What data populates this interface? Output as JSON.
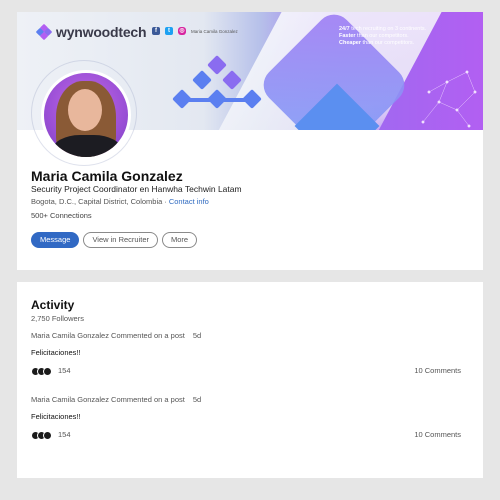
{
  "banner": {
    "brand": "wynwoodtech",
    "social_handle": "Maria Camila Gonzalez",
    "taglines": [
      {
        "bold": "24/7",
        "text": " tech recruiting on 3 continents."
      },
      {
        "bold": "Faster",
        "text": " than our competitors."
      },
      {
        "bold": "Cheaper",
        "text": " than our competitors."
      }
    ],
    "colors": {
      "accent_purple": "#b25ff2",
      "accent_blue": "#5b7ff0"
    }
  },
  "profile": {
    "name": "Maria Camila Gonzalez",
    "headline": "Security Project Coordinator en Hanwha Techwin Latam",
    "location": "Bogota, D.C., Capital District, Colombia",
    "location_sep": "·",
    "contact_link": "Contact info",
    "connections": "500+ Connections",
    "buttons": {
      "message": "Message",
      "view_recruiter": "View in Recruiter",
      "more": "More"
    }
  },
  "activity": {
    "title": "Activity",
    "followers": "2,750 Followers",
    "posts": [
      {
        "meta": "Maria Camila Gonzalez Commented on a post",
        "age": "5d",
        "text": "Felicitaciones!!",
        "reactions": "154",
        "comments": "10 Comments"
      },
      {
        "meta": "Maria Camila Gonzalez Commented on a post",
        "age": "5d",
        "text": "Felicitaciones!!",
        "reactions": "154",
        "comments": "10 Comments"
      }
    ]
  }
}
